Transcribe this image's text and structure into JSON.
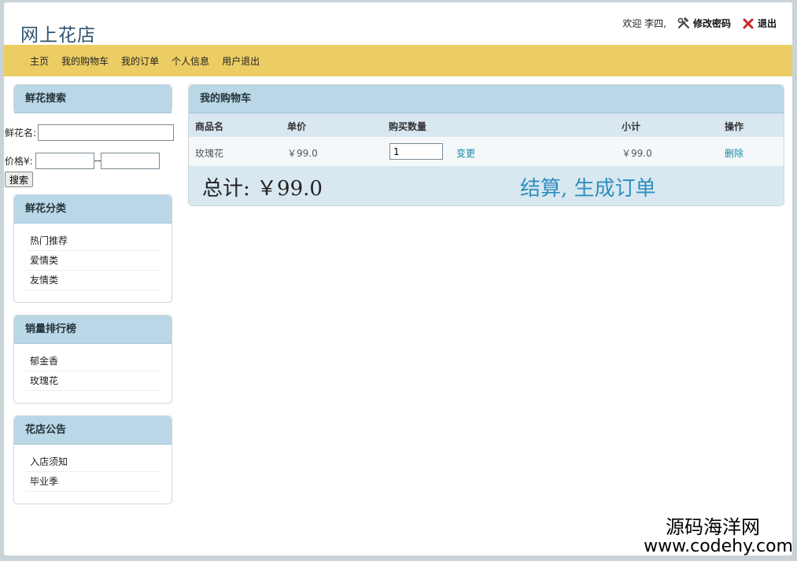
{
  "site": {
    "title": "网上花店"
  },
  "user_bar": {
    "welcome": "欢迎 李四,",
    "change_password": "修改密码",
    "logout": "退出"
  },
  "nav": [
    {
      "label": "主页"
    },
    {
      "label": "我的购物车"
    },
    {
      "label": "我的订单"
    },
    {
      "label": "个人信息"
    },
    {
      "label": "用户退出"
    }
  ],
  "search": {
    "title": "鲜花搜索",
    "name_label": "鲜花名:",
    "name_value": "",
    "price_label": "价格¥:",
    "price_sep": "--",
    "price_min": "",
    "price_max": "",
    "button": "搜索"
  },
  "category": {
    "title": "鲜花分类",
    "items": [
      {
        "label": "热门推荐"
      },
      {
        "label": "爱情类"
      },
      {
        "label": "友情类"
      }
    ]
  },
  "ranking": {
    "title": "销量排行榜",
    "items": [
      {
        "label": "郁金香"
      },
      {
        "label": "玫瑰花"
      }
    ]
  },
  "notice": {
    "title": "花店公告",
    "items": [
      {
        "label": "入店须知"
      },
      {
        "label": "毕业季"
      }
    ]
  },
  "cart": {
    "title": "我的购物车",
    "columns": {
      "name": "商品名",
      "price": "单价",
      "qty": "购买数量",
      "subtotal": "小计",
      "action": "操作"
    },
    "rows": [
      {
        "name": "玫瑰花",
        "price": "￥99.0",
        "qty": "1",
        "change": "变更",
        "subtotal": "￥99.0",
        "delete": "删除"
      }
    ],
    "total": "总计: ￥99.0",
    "checkout": "结算, 生成订单"
  },
  "watermark": {
    "line1": "源码海洋网",
    "line2": "www.codehy.com"
  },
  "colors": {
    "nav_bg": "#eccd63",
    "panel_head": "#b9d7e6",
    "link": "#1b8ba6",
    "title": "#2d5372"
  }
}
